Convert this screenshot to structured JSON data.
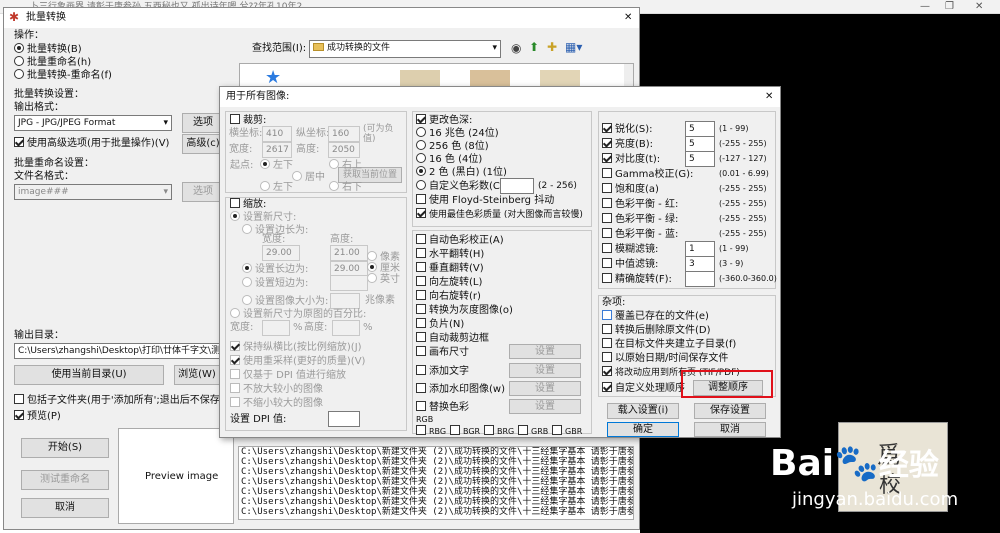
{
  "outer": {
    "title": "批量转换",
    "close": "✕",
    "bg_title": "卜三行象画界 请彰于唐参孙 五西秘也又 孤出诗年嗯 兮??年孔10年2"
  },
  "left": {
    "ops_label": "操作：",
    "ops": [
      "批量转换(B)",
      "批量重命名(h)",
      "批量转换-重命名(f)"
    ],
    "conv_label": "批量转换设置：",
    "fmt_label": "输出格式：",
    "fmt_value": "JPG - JPG/JPEG Format",
    "options_btn": "选项",
    "advanced_cb": "使用高级选项(用于批量操作)(V)",
    "advanced_btn": "高级(c)",
    "rename_label": "批量重命名设置：",
    "file_fmt_label": "文件名格式：",
    "file_fmt_value": "image###",
    "rename_options_btn": "选项",
    "out_dir_label": "输出目录：",
    "out_dir_value": "C:\\Users\\zhangshi\\Desktop\\打印\\廿体千字文\\测试",
    "use_cur_btn": "使用当前目录(U)",
    "browse_btn": "浏览(W)",
    "subfolders_cb": "包括子文件夹(用于'添加所有';退出后不保存)(x)",
    "preview_cb": "预览(P)",
    "start_btn": "开始(S)",
    "test_btn": "测试重命名",
    "cancel_btn": "取消",
    "preview_text": "Preview image"
  },
  "top": {
    "lookin_label": "查找范围(I):",
    "lookin_value": "成功转换的文件"
  },
  "log": {
    "lines": [
      "C:\\Users\\zhangshi\\Desktop\\新建文件夹 (2)\\成功转换的文件\\十三经集字基本 请彰于唐参孙 万古",
      "C:\\Users\\zhangshi\\Desktop\\新建文件夹 (2)\\成功转换的文件\\十三经集字基本 请彰于唐参孙 万古",
      "C:\\Users\\zhangshi\\Desktop\\新建文件夹 (2)\\成功转换的文件\\十三经集字基本 请彰于唐参孙 万古",
      "C:\\Users\\zhangshi\\Desktop\\新建文件夹 (2)\\成功转换的文件\\十三经集字基本 请彰于唐参孙 万古",
      "C:\\Users\\zhangshi\\Desktop\\新建文件夹 (2)\\成功转换的文件\\十三经集字基本 请彰于唐参孙 万古",
      "C:\\Users\\zhangshi\\Desktop\\新建文件夹 (2)\\成功转换的文件\\十三经集字基本 请彰于唐参孙 万古",
      "C:\\Users\\zhangshi\\Desktop\\新建文件夹 (2)\\成功转换的文件\\十三经集字基本 请彰于唐参孙 万古"
    ]
  },
  "dlg": {
    "title": "用于所有图像:",
    "close": "✕",
    "crop": {
      "cb": "裁剪:",
      "x_label": "横坐标:",
      "x": "410",
      "y_label": "纵坐标:",
      "y": "160",
      "neg": "(可为负值)",
      "w_label": "宽度:",
      "w": "2617",
      "h_label": "高度:",
      "h": "2050",
      "get_btn": "获取当前位置",
      "origin_label": "起点:",
      "opts": [
        "左下",
        "右上",
        "居中",
        "左下",
        "右下"
      ]
    },
    "resize": {
      "cb": "缩放:",
      "set_size": "设置新尺寸:",
      "set_side": "设置边长为:",
      "width_label": "宽度:",
      "height_label": "高度:",
      "width": "29.00",
      "height": "21.00",
      "long_side": "设置长边为:",
      "long_val": "29.00",
      "short_side": "设置短边为:",
      "units": [
        "像素",
        "厘米",
        "英寸"
      ],
      "img_size": "设置图像大小为:",
      "mp": "兆像素",
      "percent": "设置新尺寸为原图的百分比:",
      "pw_label": "宽度:",
      "pct": "%",
      "ph_label": "高度:",
      "keep_ratio": "保持纵横比(按比例缩放)(J)",
      "resample": "使用重采样(更好的质量)(V)",
      "dpi_only": "仅基于 DPI 值进行缩放",
      "no_enlarge": "不放大较小的图像",
      "no_shrink": "不缩小较大的图像",
      "dpi_label": "设置 DPI 值:"
    },
    "color": {
      "cb": "更改色深:",
      "opts": [
        "16 兆色 (24位)",
        "256 色 (8位)",
        "16 色 (4位)",
        "2 色 (黑白) (1位)",
        "自定义色彩数(C):"
      ],
      "custom_range": "(2 - 256)",
      "floyd": "使用 Floyd-Steinberg 抖动",
      "best": "使用最佳色彩质量 (对大图像而言较慢)"
    },
    "ops": [
      "自动色彩校正(A)",
      "水平翻转(H)",
      "垂直翻转(V)",
      "向左旋转(L)",
      "向右旋转(r)",
      "转换为灰度图像(o)",
      "负片(N)",
      "自动裁剪边框",
      "画布尺寸",
      "添加文字",
      "添加水印图像(w)",
      "替换色彩"
    ],
    "settings_btn": "设置",
    "rgb_label": "RGB",
    "rgb": [
      "RBG",
      "BGR",
      "BRG",
      "GRB",
      "GBR"
    ],
    "adj": [
      {
        "label": "锐化(S):",
        "val": "5",
        "range": "(1 - 99)"
      },
      {
        "label": "亮度(B):",
        "val": "5",
        "range": "(-255 - 255)"
      },
      {
        "label": "对比度(t):",
        "val": "5",
        "range": "(-127 - 127)"
      },
      {
        "label": "Gamma校正(G):",
        "val": "",
        "range": "(0.01 - 6.99)"
      },
      {
        "label": "饱和度(a)",
        "val": "",
        "range": "(-255 - 255)"
      },
      {
        "label": "色彩平衡 - 红:",
        "val": "",
        "range": "(-255 - 255)"
      },
      {
        "label": "色彩平衡 - 绿:",
        "val": "",
        "range": "(-255 - 255)"
      },
      {
        "label": "色彩平衡 - 蓝:",
        "val": "",
        "range": "(-255 - 255)"
      },
      {
        "label": "模糊滤镜:",
        "val": "1",
        "range": "(1 - 99)"
      },
      {
        "label": "中值滤镜:",
        "val": "3",
        "range": "(3 - 9)"
      },
      {
        "label": "精确旋转(F):",
        "val": "",
        "range": "(-360.0-360.0)"
      }
    ],
    "misc_label": "杂项:",
    "misc": [
      "覆盖已存在的文件(e)",
      "转换后删除原文件(D)",
      "在目标文件夹建立子目录(f)",
      "以原始日期/时间保存文件",
      "将改动应用到所有页 (TIF/PDF)",
      "自定义处理顺序"
    ],
    "order_btn": "调整顺序",
    "load_btn": "载入设置(i)",
    "save_btn": "保存设置",
    "ok_btn": "确定",
    "cancel_btn": "取消"
  },
  "watermark": {
    "brand": "Bai",
    "brand2": "经验",
    "url": "jingyan.baidu.com"
  },
  "highlight_color": "#e0101a"
}
